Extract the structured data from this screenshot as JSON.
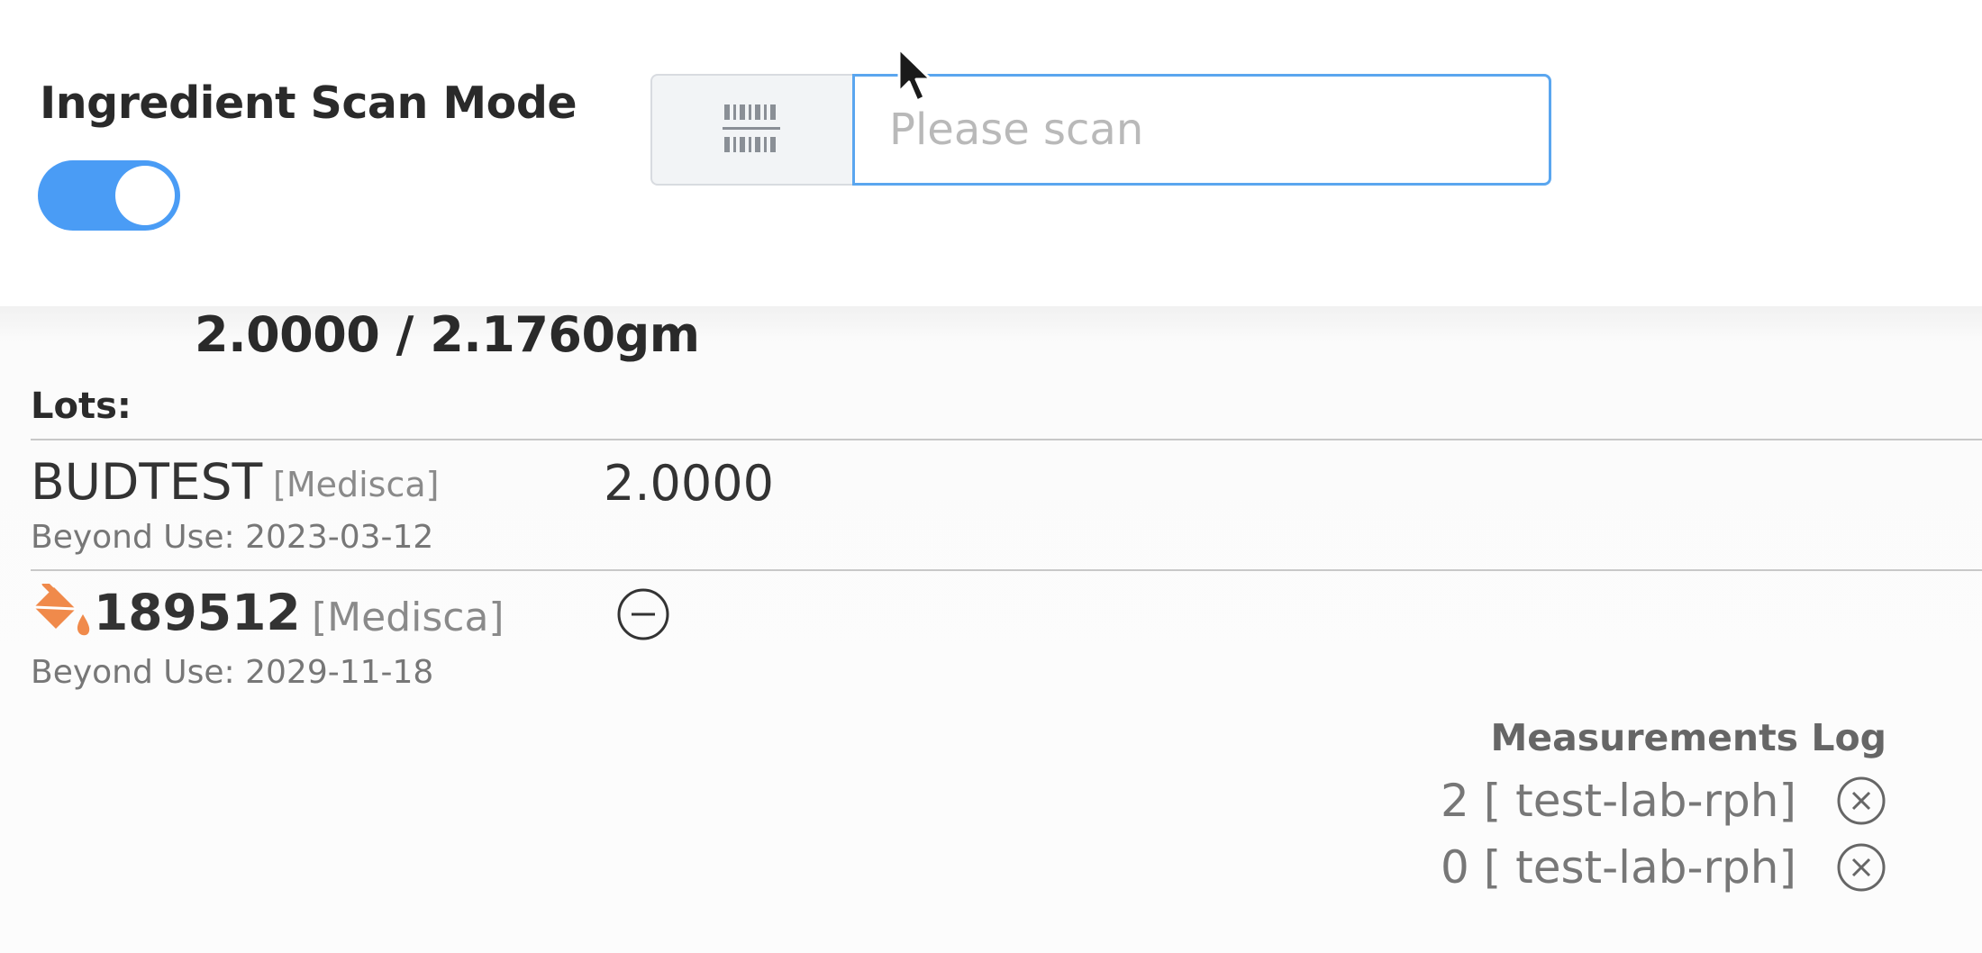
{
  "header": {
    "scan_mode_label": "Ingredient Scan Mode",
    "scan_mode_on": true,
    "scan_placeholder": "Please scan",
    "scan_value": ""
  },
  "ingredient": {
    "quantity": "2.0000 /  2.1760gm",
    "lots_label": "Lots:"
  },
  "lots": [
    {
      "name": "BUDTEST",
      "supplier": "[Medisca]",
      "beyond_use": "Beyond Use: 2023-03-12",
      "quantity": "2.0000"
    },
    {
      "name": "189512",
      "supplier": "[Medisca]",
      "beyond_use": "Beyond Use: 2029-11-18",
      "icon": "paint-bucket-icon"
    }
  ],
  "measurements_log": {
    "title": "Measurements Log",
    "entries": [
      {
        "text": "2 [ test-lab-rph]"
      },
      {
        "text": "0 [ test-lab-rph]"
      }
    ]
  },
  "colors": {
    "accent": "#4a9cf5",
    "input_border": "#5aa6ef",
    "warning_icon": "#f08a4b"
  }
}
